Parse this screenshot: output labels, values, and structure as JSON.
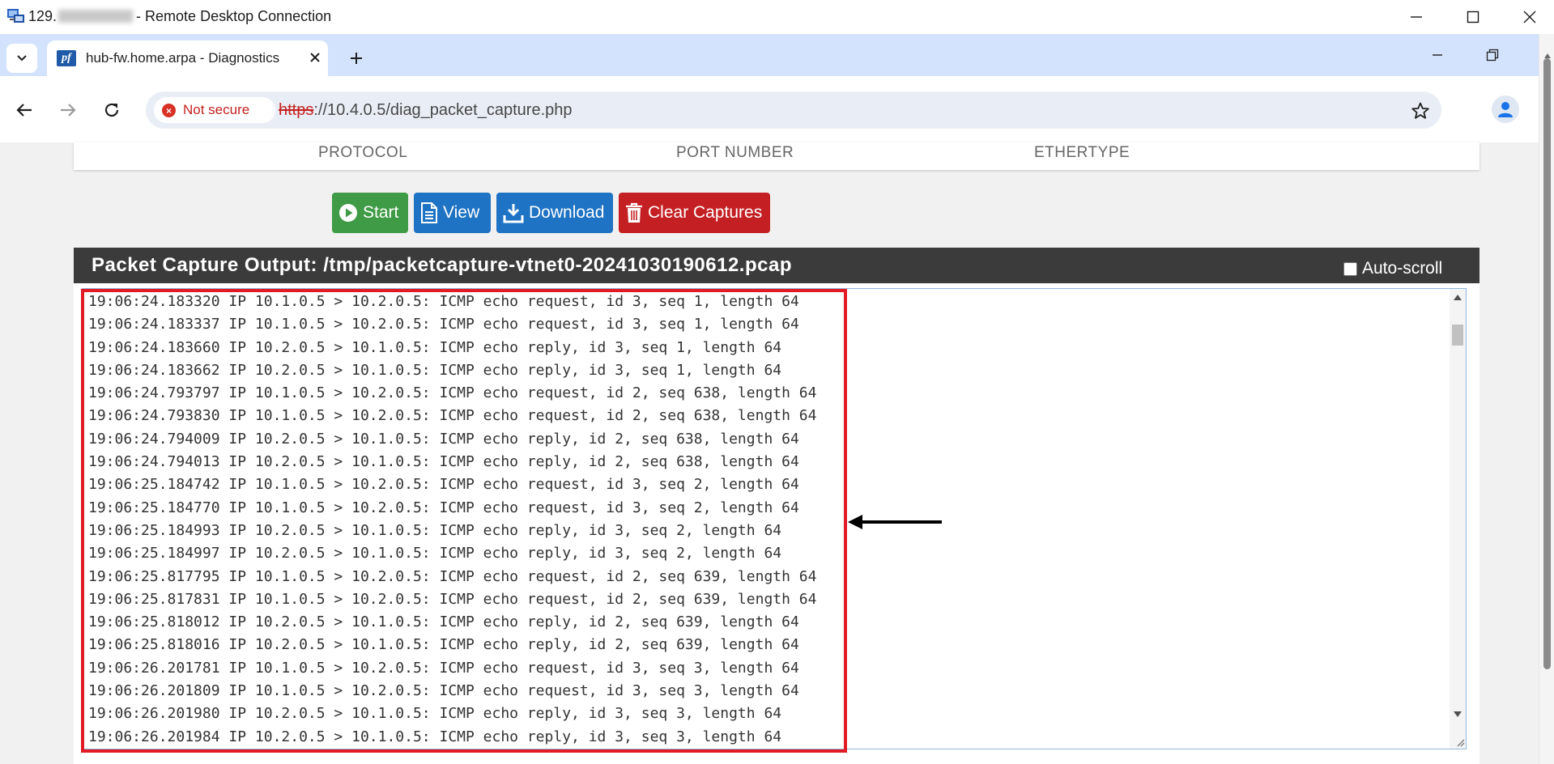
{
  "window": {
    "title_prefix": "129.",
    "title_suffix": "- Remote Desktop Connection"
  },
  "browser": {
    "tab_title": "hub-fw.home.arpa - Diagnostics",
    "security_label": "Not secure",
    "url_scheme": "https",
    "url_rest": "://10.4.0.5/diag_packet_capture.php"
  },
  "filter_columns": [
    "PROTOCOL",
    "PORT NUMBER",
    "ETHERTYPE"
  ],
  "actions": {
    "start": "Start",
    "view": "View",
    "download": "Download",
    "clear": "Clear Captures"
  },
  "output": {
    "title": "Packet Capture Output: /tmp/packetcapture-vtnet0-20241030190612.pcap",
    "autoscroll_label": "Auto-scroll",
    "autoscroll_checked": false,
    "lines": [
      "19:06:24.183320 IP 10.1.0.5 > 10.2.0.5: ICMP echo request, id 3, seq 1, length 64",
      "19:06:24.183337 IP 10.1.0.5 > 10.2.0.5: ICMP echo request, id 3, seq 1, length 64",
      "19:06:24.183660 IP 10.2.0.5 > 10.1.0.5: ICMP echo reply, id 3, seq 1, length 64",
      "19:06:24.183662 IP 10.2.0.5 > 10.1.0.5: ICMP echo reply, id 3, seq 1, length 64",
      "19:06:24.793797 IP 10.1.0.5 > 10.2.0.5: ICMP echo request, id 2, seq 638, length 64",
      "19:06:24.793830 IP 10.1.0.5 > 10.2.0.5: ICMP echo request, id 2, seq 638, length 64",
      "19:06:24.794009 IP 10.2.0.5 > 10.1.0.5: ICMP echo reply, id 2, seq 638, length 64",
      "19:06:24.794013 IP 10.2.0.5 > 10.1.0.5: ICMP echo reply, id 2, seq 638, length 64",
      "19:06:25.184742 IP 10.1.0.5 > 10.2.0.5: ICMP echo request, id 3, seq 2, length 64",
      "19:06:25.184770 IP 10.1.0.5 > 10.2.0.5: ICMP echo request, id 3, seq 2, length 64",
      "19:06:25.184993 IP 10.2.0.5 > 10.1.0.5: ICMP echo reply, id 3, seq 2, length 64",
      "19:06:25.184997 IP 10.2.0.5 > 10.1.0.5: ICMP echo reply, id 3, seq 2, length 64",
      "19:06:25.817795 IP 10.1.0.5 > 10.2.0.5: ICMP echo request, id 2, seq 639, length 64",
      "19:06:25.817831 IP 10.1.0.5 > 10.2.0.5: ICMP echo request, id 2, seq 639, length 64",
      "19:06:25.818012 IP 10.2.0.5 > 10.1.0.5: ICMP echo reply, id 2, seq 639, length 64",
      "19:06:25.818016 IP 10.2.0.5 > 10.1.0.5: ICMP echo reply, id 2, seq 639, length 64",
      "19:06:26.201781 IP 10.1.0.5 > 10.2.0.5: ICMP echo request, id 3, seq 3, length 64",
      "19:06:26.201809 IP 10.1.0.5 > 10.2.0.5: ICMP echo request, id 3, seq 3, length 64",
      "19:06:26.201980 IP 10.2.0.5 > 10.1.0.5: ICMP echo reply, id 3, seq 3, length 64",
      "19:06:26.201984 IP 10.2.0.5 > 10.1.0.5: ICMP echo reply, id 3, seq 3, length 64"
    ]
  },
  "colors": {
    "start_button": "#3f9b45",
    "primary_button": "#1e73c4",
    "danger_button": "#c42023",
    "output_header": "#3b3b3b",
    "highlight_box": "#e01b24",
    "not_secure": "#c5221f"
  },
  "icons": {
    "start": "play-circle-icon",
    "view": "file-text-icon",
    "download": "download-icon",
    "clear": "trash-icon"
  }
}
